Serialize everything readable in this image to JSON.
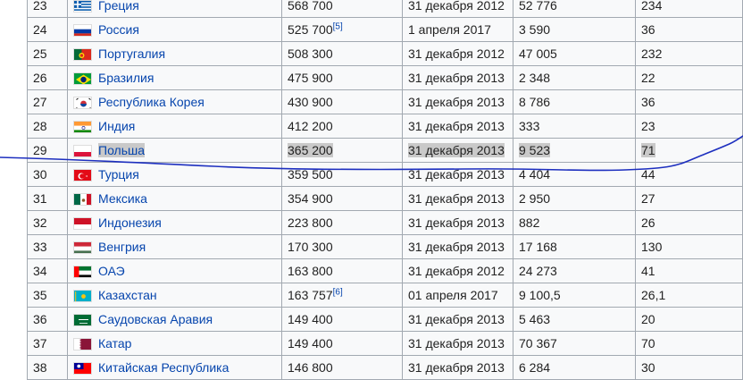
{
  "rows": [
    {
      "rank": "23",
      "country": "Греция",
      "v1": "568 700",
      "v1_ref": "",
      "date": "31 декабря 2012",
      "v3": "52 776",
      "v4": "234",
      "flag": "greece",
      "highlight": false
    },
    {
      "rank": "24",
      "country": "Россия",
      "v1": "525 700",
      "v1_ref": "[5]",
      "date": "1 апреля 2017",
      "v3": "3 590",
      "v4": "36",
      "flag": "russia",
      "highlight": false
    },
    {
      "rank": "25",
      "country": "Португалия",
      "v1": "508 300",
      "v1_ref": "",
      "date": "31 декабря 2012",
      "v3": "47 005",
      "v4": "232",
      "flag": "portugal",
      "highlight": false
    },
    {
      "rank": "26",
      "country": "Бразилия",
      "v1": "475 900",
      "v1_ref": "",
      "date": "31 декабря 2013",
      "v3": "2 348",
      "v4": "22",
      "flag": "brazil",
      "highlight": false
    },
    {
      "rank": "27",
      "country": "Республика Корея",
      "v1": "430 900",
      "v1_ref": "",
      "date": "31 декабря 2013",
      "v3": "8 786",
      "v4": "36",
      "flag": "korea",
      "highlight": false
    },
    {
      "rank": "28",
      "country": "Индия",
      "v1": "412 200",
      "v1_ref": "",
      "date": "31 декабря 2013",
      "v3": "333",
      "v4": "23",
      "flag": "india",
      "highlight": false
    },
    {
      "rank": "29",
      "country": "Польша",
      "v1": "365 200",
      "v1_ref": "",
      "date": "31 декабря 2013",
      "v3": "9 523",
      "v4": "71",
      "flag": "poland",
      "highlight": true
    },
    {
      "rank": "30",
      "country": "Турция",
      "v1": "359 500",
      "v1_ref": "",
      "date": "31 декабря 2013",
      "v3": "4 404",
      "v4": "44",
      "flag": "turkey",
      "highlight": false
    },
    {
      "rank": "31",
      "country": "Мексика",
      "v1": "354 900",
      "v1_ref": "",
      "date": "31 декабря 2013",
      "v3": "2 950",
      "v4": "27",
      "flag": "mexico",
      "highlight": false
    },
    {
      "rank": "32",
      "country": "Индонезия",
      "v1": "223 800",
      "v1_ref": "",
      "date": "31 декабря 2013",
      "v3": "882",
      "v4": "26",
      "flag": "indonesia",
      "highlight": false
    },
    {
      "rank": "33",
      "country": "Венгрия",
      "v1": "170 300",
      "v1_ref": "",
      "date": "31 декабря 2013",
      "v3": "17 168",
      "v4": "130",
      "flag": "hungary",
      "highlight": false
    },
    {
      "rank": "34",
      "country": "ОАЭ",
      "v1": "163 800",
      "v1_ref": "",
      "date": "31 декабря 2012",
      "v3": "24 273",
      "v4": "41",
      "flag": "uae",
      "highlight": false
    },
    {
      "rank": "35",
      "country": "Казахстан",
      "v1": "163 757",
      "v1_ref": "[6]",
      "date": "01 апреля 2017",
      "v3": "9 100,5",
      "v4": "26,1",
      "flag": "kazakhstan",
      "highlight": false
    },
    {
      "rank": "36",
      "country": "Саудовская Аравия",
      "v1": "149 400",
      "v1_ref": "",
      "date": "31 декабря 2013",
      "v3": "5 463",
      "v4": "20",
      "flag": "saudi",
      "highlight": false
    },
    {
      "rank": "37",
      "country": "Катар",
      "v1": "149 400",
      "v1_ref": "",
      "date": "31 декабря 2013",
      "v3": "70 367",
      "v4": "70",
      "flag": "qatar",
      "highlight": false
    },
    {
      "rank": "38",
      "country": "Китайская Республика",
      "v1": "146 800",
      "v1_ref": "",
      "date": "31 декабря 2013",
      "v3": "6 284",
      "v4": "30",
      "flag": "taiwan",
      "highlight": false
    }
  ],
  "colors": {
    "link": "#0645ad",
    "border": "#a2a9b1",
    "row_bg": "#f8f9fa",
    "highlight": "#c9c9c9",
    "pen_line": "#1d2fbf"
  }
}
